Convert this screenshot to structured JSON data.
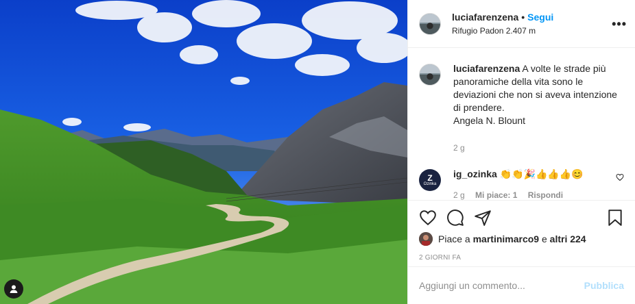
{
  "post": {
    "username": "luciafarenzena",
    "follow_label": "Segui",
    "separator": "•",
    "location": "Rifugio Padon 2.407 m",
    "more_label": "•••"
  },
  "caption": {
    "username": "luciafarenzena",
    "lines": [
      "A volte le strade più",
      "panoramiche della vita sono le",
      "deviazioni che non si aveva intenzione",
      "di prendere.",
      "Angela N. Blount"
    ],
    "age": "2 g"
  },
  "reply": {
    "username": "ig_ozinka",
    "avatar_text": "Z",
    "avatar_subtext": "Ozinka",
    "emojis": "👏👏🎉👍👍👍😊",
    "age": "2 g",
    "likes": "Mi piace: 1",
    "reply_label": "Rispondi"
  },
  "likes": {
    "prefix": "Piace a",
    "user": "martinimarco9",
    "mid": "e",
    "others": "altri 224"
  },
  "date": "2 GIORNI FA",
  "comment_box": {
    "placeholder": "Aggiungi un commento...",
    "publish_label": "Pubblica"
  },
  "colors": {
    "accent": "#0095f6",
    "publish_disabled": "#b2dffc",
    "muted": "#8e8e8e"
  }
}
